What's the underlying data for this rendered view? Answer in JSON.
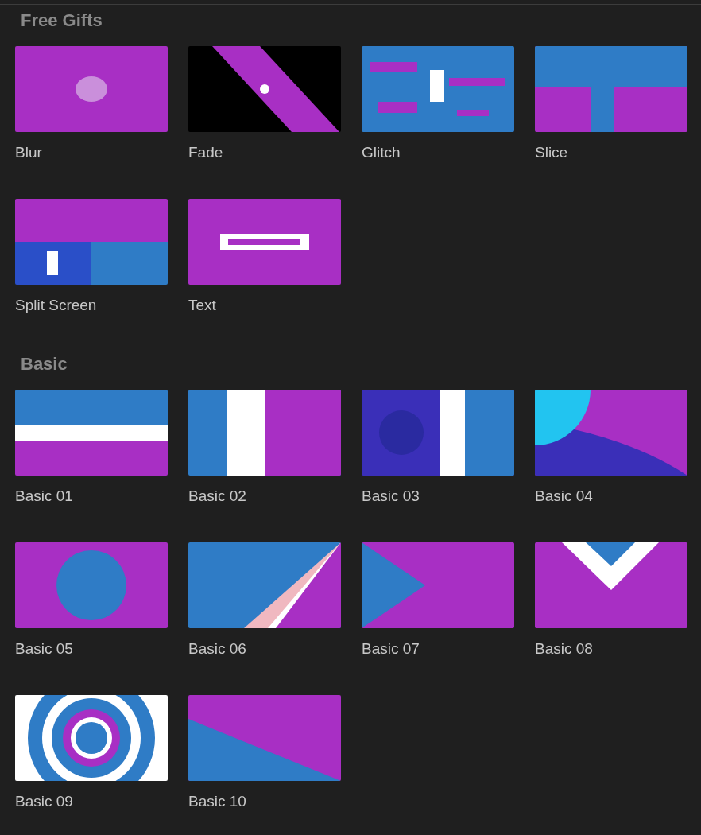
{
  "sections": [
    {
      "title": "Free Gifts",
      "items": [
        {
          "label": "Blur"
        },
        {
          "label": "Fade"
        },
        {
          "label": "Glitch"
        },
        {
          "label": "Slice"
        },
        {
          "label": "Split Screen"
        },
        {
          "label": "Text"
        }
      ]
    },
    {
      "title": "Basic",
      "items": [
        {
          "label": "Basic 01"
        },
        {
          "label": "Basic 02"
        },
        {
          "label": "Basic 03"
        },
        {
          "label": "Basic 04"
        },
        {
          "label": "Basic 05"
        },
        {
          "label": "Basic 06"
        },
        {
          "label": "Basic 07"
        },
        {
          "label": "Basic 08"
        },
        {
          "label": "Basic 09"
        },
        {
          "label": "Basic 10"
        }
      ]
    }
  ]
}
